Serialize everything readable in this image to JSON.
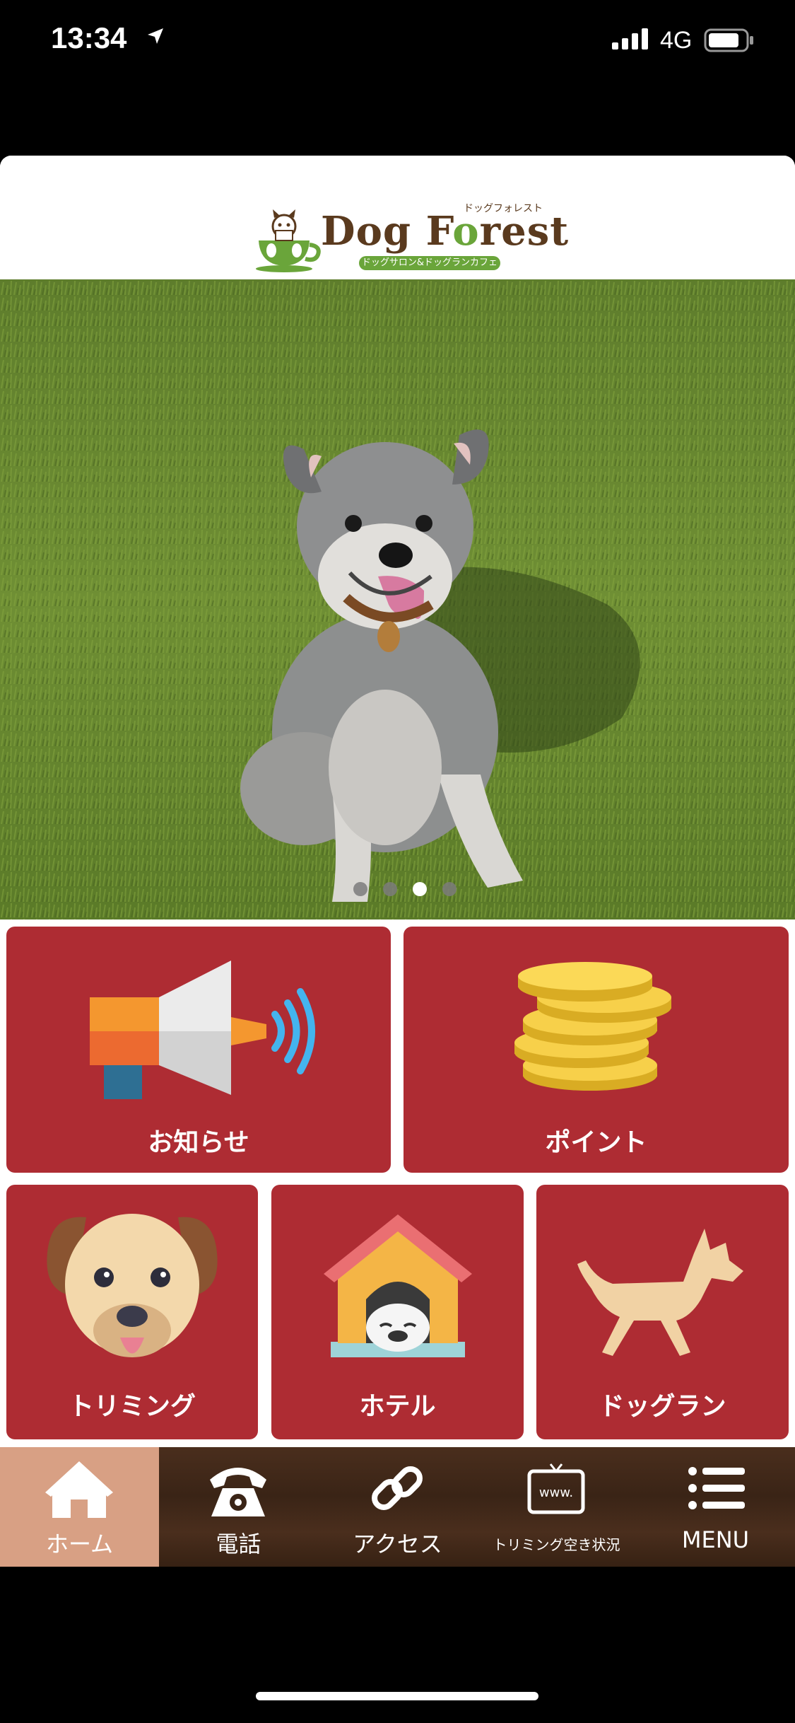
{
  "status_bar": {
    "time": "13:34",
    "network": "4G"
  },
  "header": {
    "logo_text_a": "Dog F",
    "logo_text_b": "o",
    "logo_text_c": "rest",
    "logo_kana": "ドッグフォレスト",
    "logo_sub": "ドッグサロン&ドッグランカフェ"
  },
  "hero": {
    "slides": 4,
    "active_slide": 3
  },
  "tiles": {
    "news": "お知らせ",
    "points": "ポイント",
    "trimming": "トリミング",
    "hotel": "ホテル",
    "dogrun": "ドッグラン"
  },
  "tabbar": {
    "items": [
      {
        "label": "ホーム",
        "icon": "home-icon",
        "active": true
      },
      {
        "label": "電話",
        "icon": "phone-icon",
        "active": false
      },
      {
        "label": "アクセス",
        "icon": "link-icon",
        "active": false
      },
      {
        "label": "トリミング空き状況",
        "icon": "www-icon",
        "active": false
      },
      {
        "label": "MENU",
        "icon": "menu-icon",
        "active": false
      }
    ]
  },
  "colors": {
    "tile_red": "#ae2c33",
    "tab_active": "#d8a084",
    "tab_bg": "#3a2416",
    "brand_green": "#6aa53a",
    "brand_brown": "#5a3a1e"
  }
}
